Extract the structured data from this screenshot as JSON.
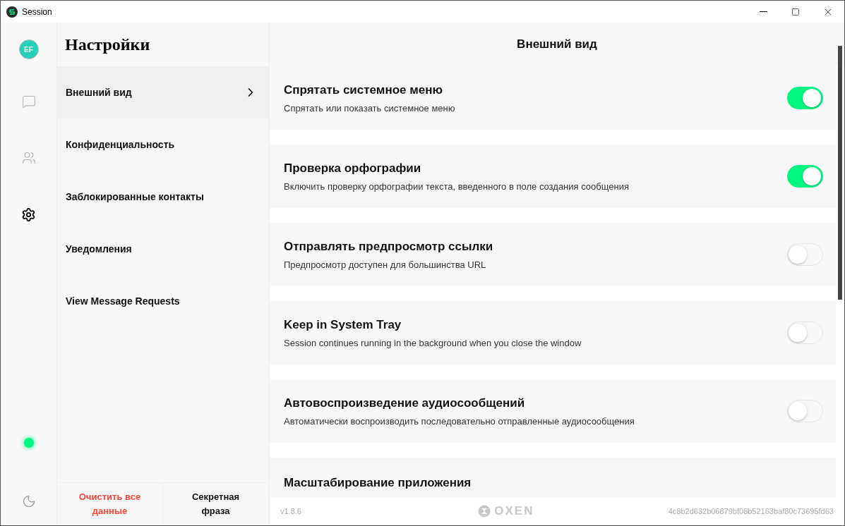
{
  "window": {
    "title": "Session"
  },
  "rail": {
    "avatar": "EF",
    "items": [
      {
        "kind": "chat",
        "selected": false
      },
      {
        "kind": "contacts",
        "selected": false
      },
      {
        "kind": "settings",
        "selected": true
      }
    ],
    "online": true
  },
  "menu": {
    "title": "Настройки",
    "items": [
      {
        "label": "Внешний вид",
        "selected": true
      },
      {
        "label": "Конфиденциальность",
        "selected": false
      },
      {
        "label": "Заблокированные контакты",
        "selected": false
      },
      {
        "label": "Уведомления",
        "selected": false
      },
      {
        "label": "View Message Requests",
        "selected": false
      }
    ],
    "buttons": [
      {
        "label": "Очистить все данные",
        "kind": "danger"
      },
      {
        "label": "Секретная фраза",
        "kind": "normal"
      }
    ]
  },
  "content": {
    "title": "Внешний вид",
    "settings": [
      {
        "title": "Спрятать системное меню",
        "description": "Спрятать или показать системное меню",
        "on": true
      },
      {
        "title": "Проверка орфографии",
        "description": "Включить проверку орфографии текста, введенного в поле создания сообщения",
        "on": true
      },
      {
        "title": "Отправлять предпросмотр ссылки",
        "description": "Предпросмотр доступен для большинства URL",
        "on": false
      },
      {
        "title": "Keep in System Tray",
        "description": "Session continues running in the background when you close the window",
        "on": false
      },
      {
        "title": "Автовоспроизведение аудиосообщений",
        "description": "Автоматически воспроизводить последовательно отправленные аудиосообщения",
        "on": false
      },
      {
        "title": "Масштабирование приложения"
      }
    ]
  },
  "footer": {
    "version": "v1.8.6",
    "logo": "OXEN",
    "hash": "4c8b2d632b06879bf08b52163baf80c73695fd63"
  }
}
